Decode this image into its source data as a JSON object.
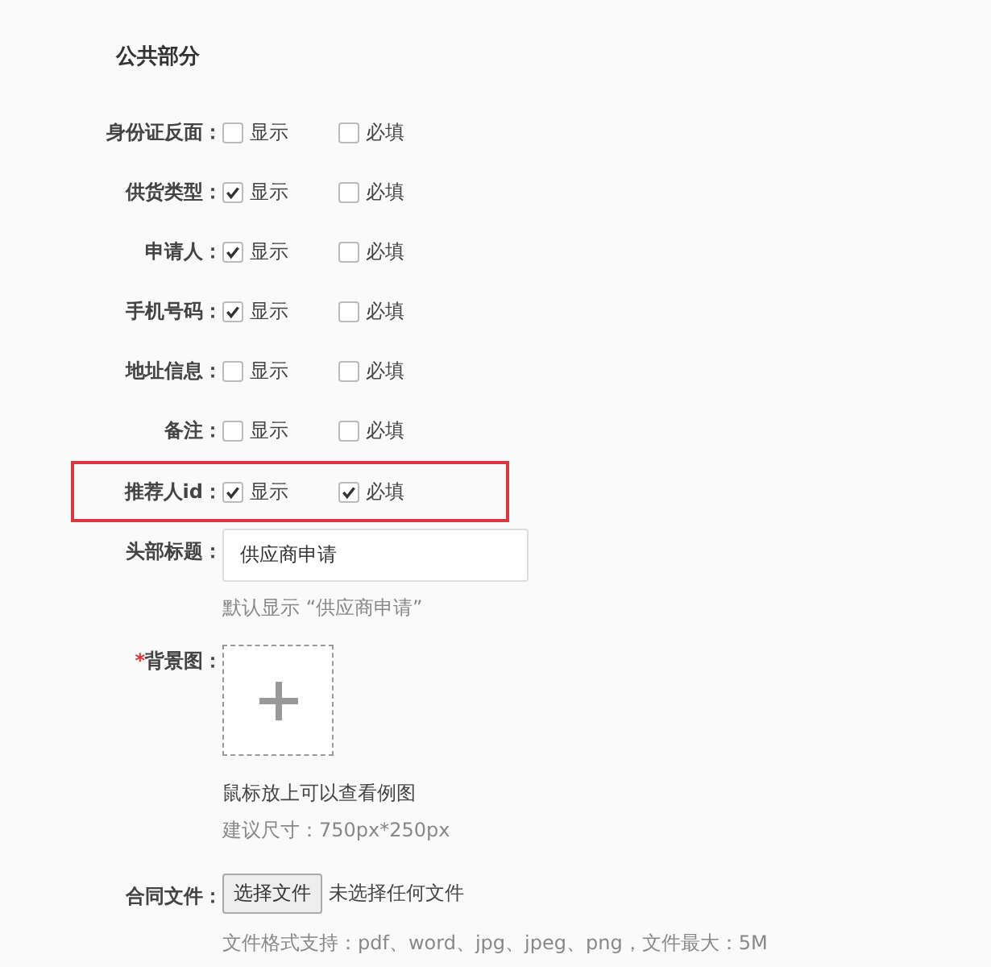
{
  "section_title": "公共部分",
  "fields": [
    {
      "label": "身份证反面：",
      "show": {
        "label": "显示",
        "checked": false
      },
      "required": {
        "label": "必填",
        "checked": false
      },
      "highlighted": false
    },
    {
      "label": "供货类型：",
      "show": {
        "label": "显示",
        "checked": true
      },
      "required": {
        "label": "必填",
        "checked": false
      },
      "highlighted": false
    },
    {
      "label": "申请人：",
      "show": {
        "label": "显示",
        "checked": true
      },
      "required": {
        "label": "必填",
        "checked": false
      },
      "highlighted": false
    },
    {
      "label": "手机号码：",
      "show": {
        "label": "显示",
        "checked": true
      },
      "required": {
        "label": "必填",
        "checked": false
      },
      "highlighted": false
    },
    {
      "label": "地址信息：",
      "show": {
        "label": "显示",
        "checked": false
      },
      "required": {
        "label": "必填",
        "checked": false
      },
      "highlighted": false
    },
    {
      "label": "备注：",
      "show": {
        "label": "显示",
        "checked": false
      },
      "required": {
        "label": "必填",
        "checked": false
      },
      "highlighted": false
    },
    {
      "label": "推荐人id：",
      "show": {
        "label": "显示",
        "checked": true
      },
      "required": {
        "label": "必填",
        "checked": true
      },
      "highlighted": true
    }
  ],
  "header_title": {
    "label": "头部标题：",
    "value": "供应商申请",
    "hint": "默认显示 “供应商申请”"
  },
  "background": {
    "required_mark": "*",
    "label": "背景图：",
    "hint": "鼠标放上可以查看例图",
    "size_hint": "建议尺寸：750px*250px"
  },
  "contract": {
    "label": "合同文件：",
    "button": "选择文件",
    "status": "未选择任何文件",
    "hint": "文件格式支持：pdf、word、jpg、jpeg、png，文件最大：5M"
  }
}
